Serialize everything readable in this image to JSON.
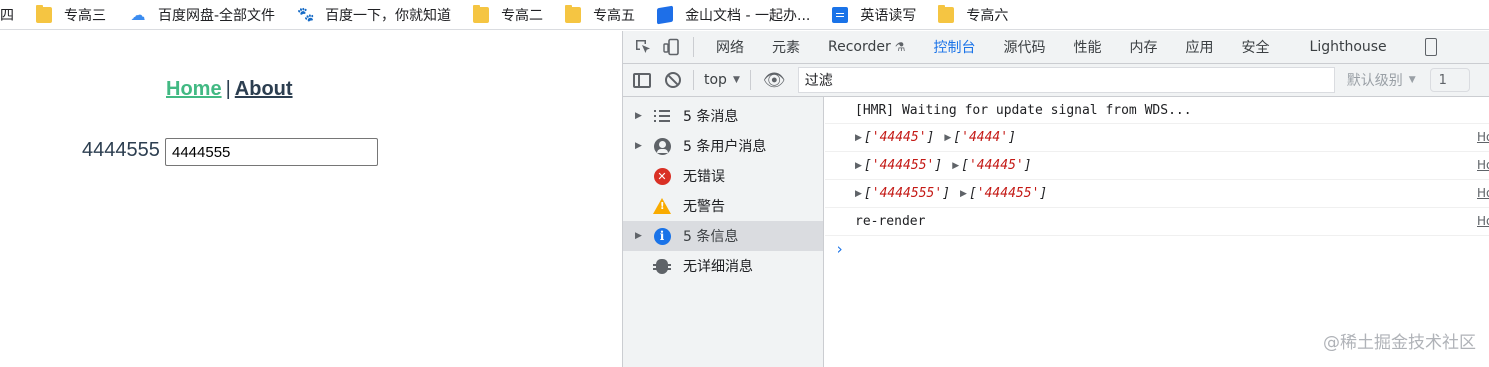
{
  "bookmarks": [
    {
      "label": "四",
      "icon": "none"
    },
    {
      "label": "专高三",
      "icon": "folder-icon"
    },
    {
      "label": "百度网盘-全部文件",
      "icon": "cloud-icon"
    },
    {
      "label": "百度一下，你就知道",
      "icon": "paw-icon"
    },
    {
      "label": "专高二",
      "icon": "folder-icon"
    },
    {
      "label": "专高五",
      "icon": "folder-icon"
    },
    {
      "label": "金山文档 - 一起办...",
      "icon": "wps-icon"
    },
    {
      "label": "英语读写",
      "icon": "doc-icon"
    },
    {
      "label": "专高六",
      "icon": "folder-icon"
    }
  ],
  "app": {
    "nav": {
      "home": "Home",
      "separator": "|",
      "about": "About"
    },
    "value_text": "4444555",
    "input_value": "4444555"
  },
  "devtools": {
    "tabs": [
      "网络",
      "元素",
      "Recorder",
      "控制台",
      "源代码",
      "性能",
      "内存",
      "应用",
      "安全",
      "Lighthouse"
    ],
    "active_tab": "控制台",
    "recorder_flask": "⚗",
    "toolbar": {
      "context": "top",
      "filter_placeholder": "过滤",
      "levels": "默认级别",
      "issues": "1"
    },
    "sidebar": [
      {
        "label": "5 条消息",
        "expandable": true,
        "icon": "list-icon"
      },
      {
        "label": "5 条用户消息",
        "expandable": true,
        "icon": "user-icon"
      },
      {
        "label": "无错误",
        "expandable": false,
        "icon": "error-icon"
      },
      {
        "label": "无警告",
        "expandable": false,
        "icon": "warning-icon"
      },
      {
        "label": "5 条信息",
        "expandable": true,
        "icon": "info-icon",
        "selected": true
      },
      {
        "label": "无详细消息",
        "expandable": false,
        "icon": "bug-icon"
      }
    ],
    "console": {
      "hmr": "[HMR] Waiting for update signal from WDS...",
      "logs": [
        {
          "a": "'44445'",
          "b": "'4444'",
          "source": "Ho"
        },
        {
          "a": "'444455'",
          "b": "'44445'",
          "source": "Ho"
        },
        {
          "a": "'4444555'",
          "b": "'444455'",
          "source": "Ho"
        }
      ],
      "rerender": "re-render",
      "rerender_source": "Ho",
      "prompt": "›"
    }
  },
  "watermark": "@稀土掘金技术社区",
  "colors": {
    "vue_green": "#42b983",
    "vue_dark": "#2c3e50",
    "devtools_blue": "#1a73e8",
    "string_red": "#c41a16"
  }
}
